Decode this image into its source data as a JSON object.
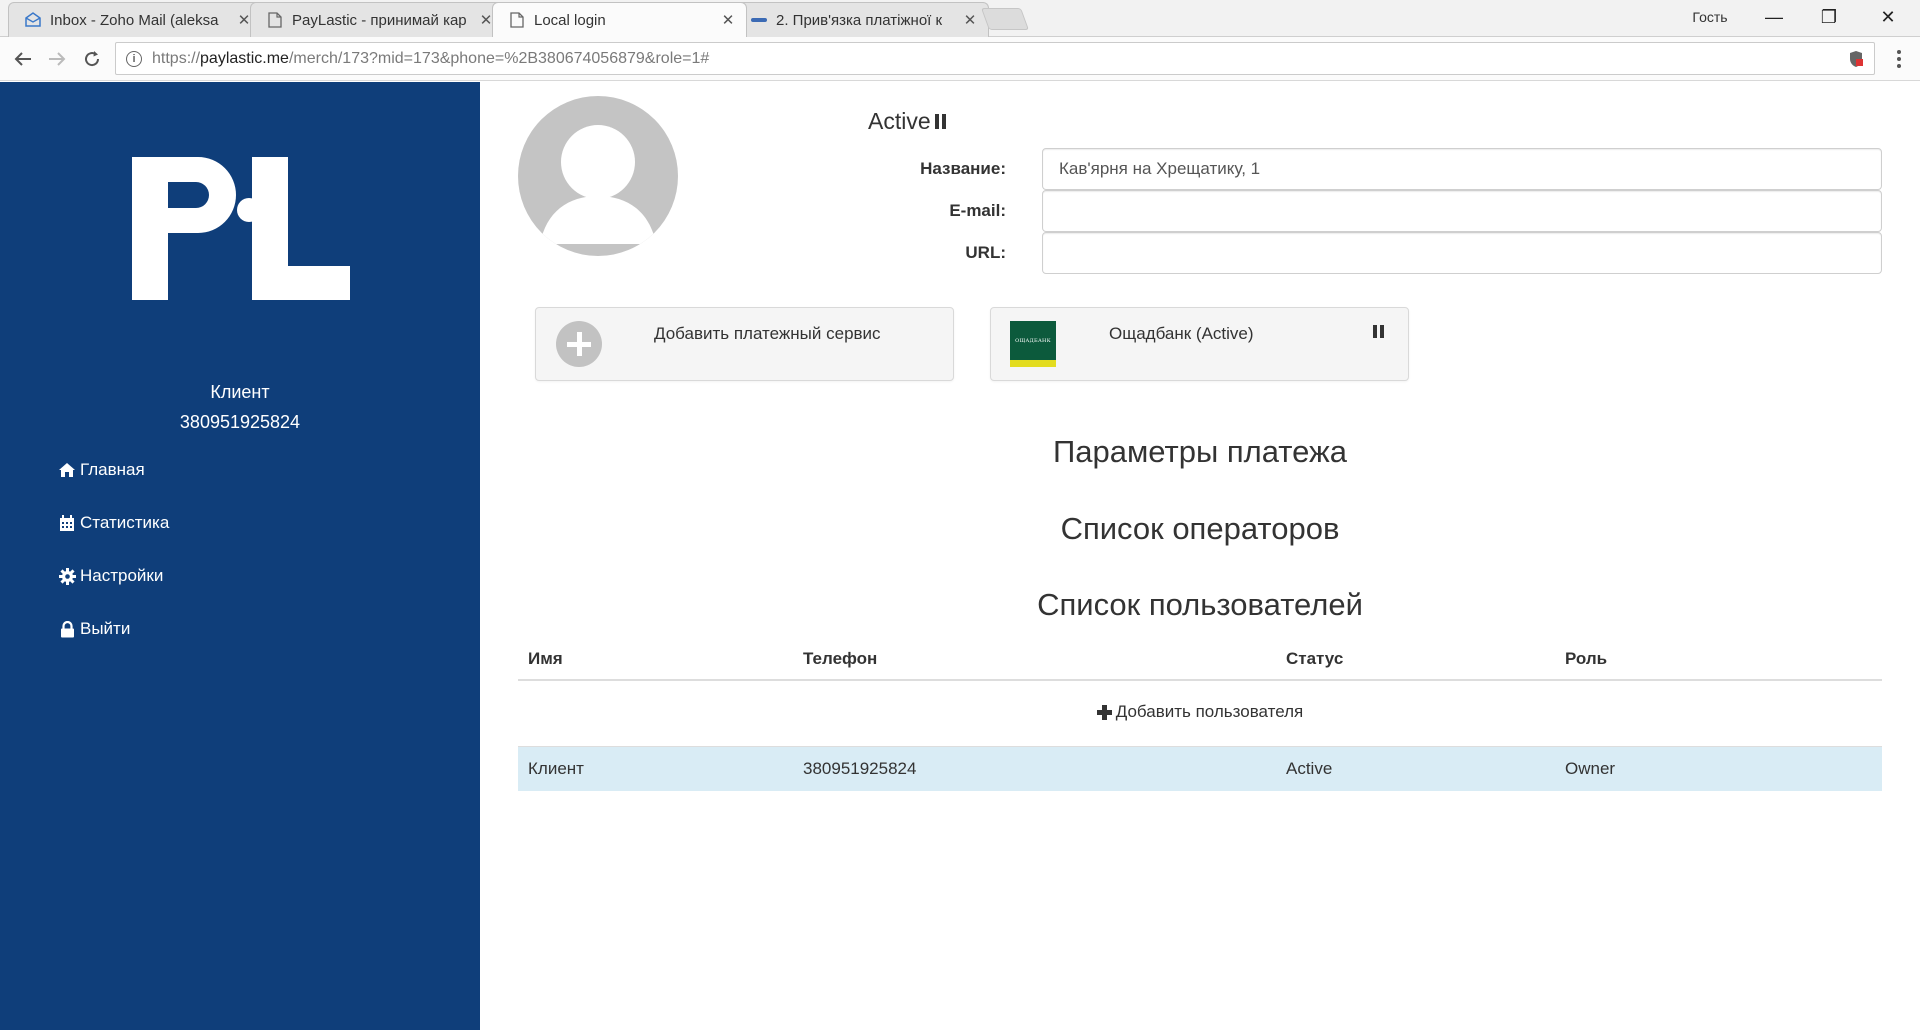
{
  "browser": {
    "tabs": [
      {
        "title": "Inbox - Zoho Mail (aleksa",
        "icon": "mail-icon",
        "active": false
      },
      {
        "title": "PayLastic - принимай кар",
        "icon": "document-icon",
        "active": false
      },
      {
        "title": "Local login",
        "icon": "document-icon",
        "active": true
      },
      {
        "title": "2. Прив'язка платіжної к",
        "icon": "site-favicon-icon",
        "active": false
      }
    ],
    "tab_close_glyph": "✕",
    "user_label": "Гость",
    "window_buttons": {
      "minimize": "—",
      "restore": "❐",
      "close": "✕"
    },
    "url": {
      "scheme": "https://",
      "host": "paylastic.me",
      "path": "/merch/173?mid=173&phone=%2B380674056879&role=1#"
    }
  },
  "sidebar": {
    "logo_text": "PL",
    "client_name": "Клиент",
    "client_phone": "380951925824",
    "nav": [
      {
        "label": "Главная",
        "icon": "home-icon"
      },
      {
        "label": "Статистика",
        "icon": "calendar-icon"
      },
      {
        "label": "Настройки",
        "icon": "gear-icon"
      },
      {
        "label": "Выйти",
        "icon": "lock-icon"
      }
    ]
  },
  "profile": {
    "status": "Active",
    "fields": {
      "name_label": "Название:",
      "name_value": "Кав'ярня на Хрещатику, 1",
      "email_label": "E-mail:",
      "email_value": "",
      "url_label": "URL:",
      "url_value": ""
    }
  },
  "services": {
    "add_label": "Добавить платежный сервис",
    "bank_label": "Ощадбанк (Active)",
    "bank_logo_text": "ОЩАДБАНК"
  },
  "sections": {
    "payment_params": "Параметры платежа",
    "operators": "Список операторов",
    "users": "Список пользователей"
  },
  "users_table": {
    "headers": [
      "Имя",
      "Телефон",
      "Статус",
      "Роль"
    ],
    "add_user_label": "Добавить пользователя",
    "rows": [
      {
        "name": "Клиент",
        "phone": "380951925824",
        "status": "Active",
        "role": "Owner"
      }
    ]
  },
  "colors": {
    "sidebar_bg": "#0f3e7a",
    "row_highlight": "#d9ecf5",
    "bank_green": "#0c5a3c",
    "bank_yellow": "#e3dc1f"
  }
}
